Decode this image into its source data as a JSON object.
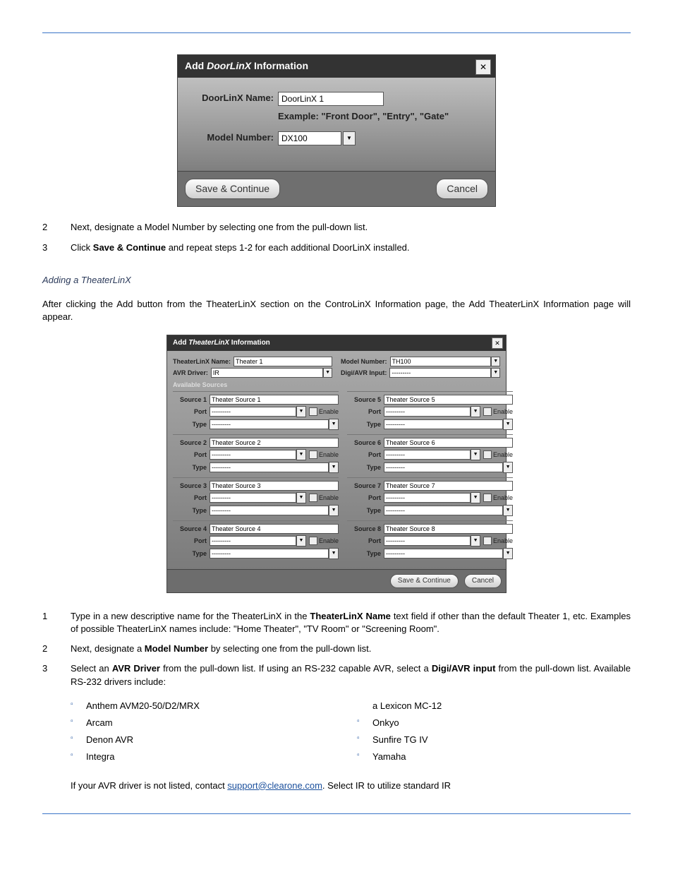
{
  "header": {
    "left": "",
    "right": ""
  },
  "dialog1": {
    "title_plain": "Add ",
    "title_italic": "DoorLinX",
    "title_suffix": " Information",
    "close": "✕",
    "name_label": "DoorLinX Name:",
    "name_value": "DoorLinX 1",
    "example_text": "Example: \"Front Door\", \"Entry\", \"Gate\"",
    "model_label": "Model Number:",
    "model_value": "DX100",
    "save": "Save & Continue",
    "cancel": "Cancel"
  },
  "text1": {
    "step2_num": "2",
    "step2_txt": "Next, designate a Model Number by selecting one from the pull-down list.",
    "step3_num": "3",
    "step3_txt_a": "Click ",
    "step3_bold": "Save & Continue",
    "step3_txt_b": " and repeat steps 1-2 for each additional DoorLinX installed."
  },
  "theater": {
    "heading": "Adding a TheaterLinX",
    "para": "After clicking the Add button from the TheaterLinX section on the ControLinX Information page, the Add TheaterLinX Information page will appear."
  },
  "dialog2": {
    "title_plain": "Add ",
    "title_italic": "TheaterLinX",
    "title_suffix": " Information",
    "close": "✕",
    "name_label": "TheaterLinX Name:",
    "name_value": "Theater 1",
    "model_label": "Model Number:",
    "model_value": "TH100",
    "avr_label": "AVR Driver:",
    "avr_value": "IR",
    "digi_label": "Digi/AVR Input:",
    "digi_value": "---------",
    "avail": "Available Sources",
    "enable": "Enable",
    "port_label": "Port",
    "type_label": "Type",
    "dashes": "---------",
    "sources_left": [
      {
        "lbl": "Source 1",
        "val": "Theater Source 1"
      },
      {
        "lbl": "Source 2",
        "val": "Theater Source 2"
      },
      {
        "lbl": "Source 3",
        "val": "Theater Source 3"
      },
      {
        "lbl": "Source 4",
        "val": "Theater Source 4"
      }
    ],
    "sources_right": [
      {
        "lbl": "Source 5",
        "val": "Theater Source 5"
      },
      {
        "lbl": "Source 6",
        "val": "Theater Source 6"
      },
      {
        "lbl": "Source 7",
        "val": "Theater Source 7"
      },
      {
        "lbl": "Source 8",
        "val": "Theater Source 8"
      }
    ],
    "save": "Save & Continue",
    "cancel": "Cancel"
  },
  "belowtext": {
    "step1_num": "1",
    "step1_a": "Type in a new descriptive name for the TheaterLinX in the ",
    "step1_bold": "TheaterLinX Name",
    "step1_b": " text field if other than the default Theater 1, etc. Examples of possible TheaterLinX names include: \"Home Theater\", \"TV Room\" or \"Screening Room\".",
    "step2_num": "2",
    "step2_a": "Next, designate a ",
    "step2_bold": "Model Number",
    "step2_b": " by selecting one from the pull-down list.",
    "step3_num": "3",
    "step3_a": "Select an ",
    "step3_bold1": "AVR Driver",
    "step3_mid": " from the pull-down list. If using an RS-232 capable AVR, select a ",
    "step3_bold2": "Digi/AVR input",
    "step3_b": " from the pull-down list. Available RS-232 drivers include:"
  },
  "avr_cols": {
    "left": [
      "Anthem AVM20-50/D2/MRX",
      "Arcam",
      "Denon AVR",
      "Integra"
    ],
    "right": [
      "a Lexicon MC-12",
      "Onkyo",
      "Sunfire TG IV",
      "Yamaha"
    ]
  },
  "lastline": {
    "a": "If your AVR driver is not listed, contact ",
    "link": "support@clearone.com",
    "b": ". Select IR to utilize standard IR"
  },
  "footer": {
    "left": "",
    "right": ""
  }
}
